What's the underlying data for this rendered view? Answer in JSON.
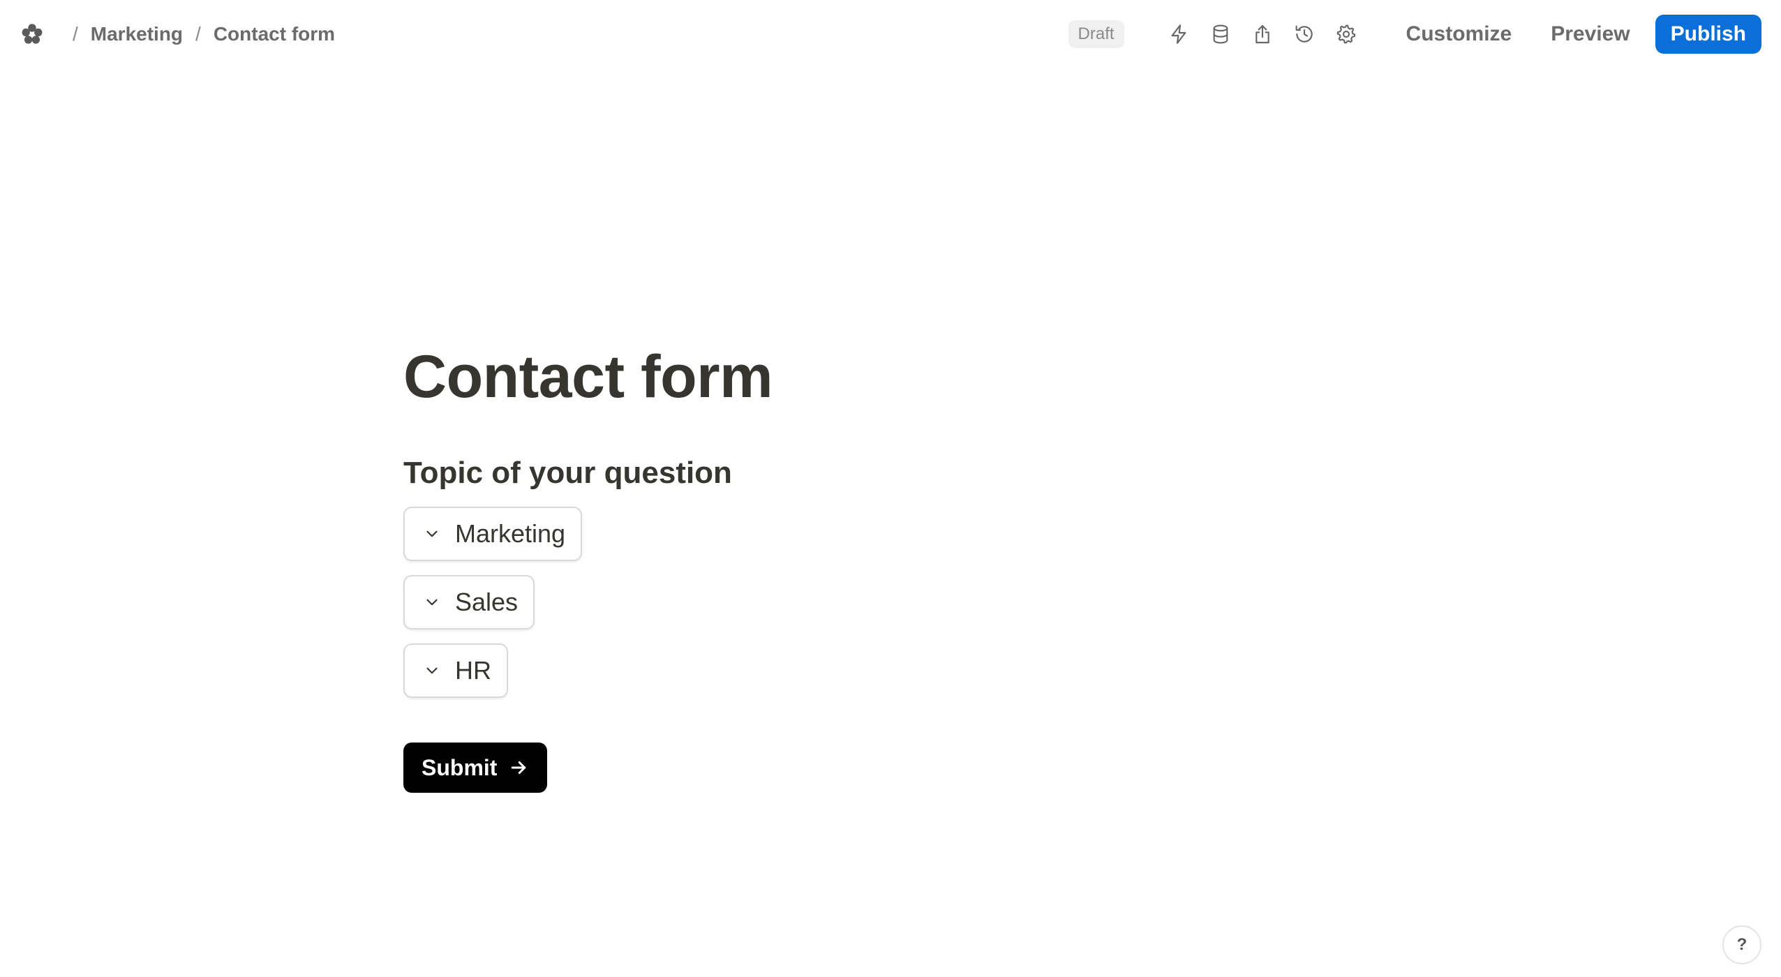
{
  "breadcrumb": {
    "logo_icon": "asterisk-flower-icon",
    "separator": "/",
    "items": [
      "Marketing",
      "Contact form"
    ]
  },
  "toolbar": {
    "status_badge": "Draft",
    "icons": [
      "lightning-icon",
      "database-icon",
      "share-icon",
      "history-icon",
      "settings-icon"
    ],
    "customize_label": "Customize",
    "preview_label": "Preview",
    "publish_label": "Publish",
    "accent_color": "#0b6fd9"
  },
  "form": {
    "title": "Contact form",
    "question": "Topic of your question",
    "options": [
      {
        "label": "Marketing"
      },
      {
        "label": "Sales"
      },
      {
        "label": "HR"
      }
    ],
    "submit_label": "Submit"
  },
  "help": {
    "label": "?"
  }
}
